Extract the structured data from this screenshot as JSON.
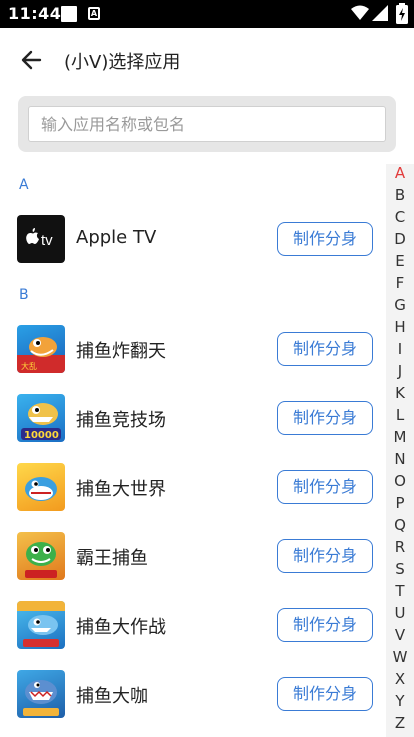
{
  "status_bar": {
    "time": "11:44",
    "a_icon_text": "A",
    "icons": [
      "notification-square-icon",
      "a-notification-icon",
      "wifi-icon",
      "signal-icon",
      "battery-icon"
    ]
  },
  "header": {
    "back_icon": "arrow-left-icon",
    "title": "(小V)选择应用"
  },
  "search": {
    "placeholder": "输入应用名称或包名",
    "value": ""
  },
  "sections": [
    {
      "letter": "A",
      "apps": [
        {
          "name": "Apple TV",
          "icon": "apple-tv-icon",
          "button": "制作分身"
        }
      ]
    },
    {
      "letter": "B",
      "apps": [
        {
          "name": "捕鱼炸翻天",
          "icon": "fish-game-icon-1",
          "button": "制作分身"
        },
        {
          "name": "捕鱼竞技场",
          "icon": "fish-game-icon-2",
          "button": "制作分身",
          "icon_badge": "10000"
        },
        {
          "name": "捕鱼大世界",
          "icon": "fish-game-icon-3",
          "button": "制作分身"
        },
        {
          "name": "霸王捕鱼",
          "icon": "fish-game-icon-4",
          "button": "制作分身"
        },
        {
          "name": "捕鱼大作战",
          "icon": "fish-game-icon-5",
          "button": "制作分身"
        },
        {
          "name": "捕鱼大咖",
          "icon": "fish-game-icon-6",
          "button": "制作分身"
        }
      ]
    }
  ],
  "apple_tv_label": "tv",
  "alphabet": [
    "A",
    "B",
    "C",
    "D",
    "E",
    "F",
    "G",
    "H",
    "I",
    "J",
    "K",
    "L",
    "M",
    "N",
    "O",
    "P",
    "Q",
    "R",
    "S",
    "T",
    "U",
    "V",
    "W",
    "X",
    "Y",
    "Z"
  ],
  "alphabet_active": "A",
  "colors": {
    "accent": "#3a7bd5",
    "active_letter": "#e23b3b",
    "status_bar": "#000000"
  }
}
